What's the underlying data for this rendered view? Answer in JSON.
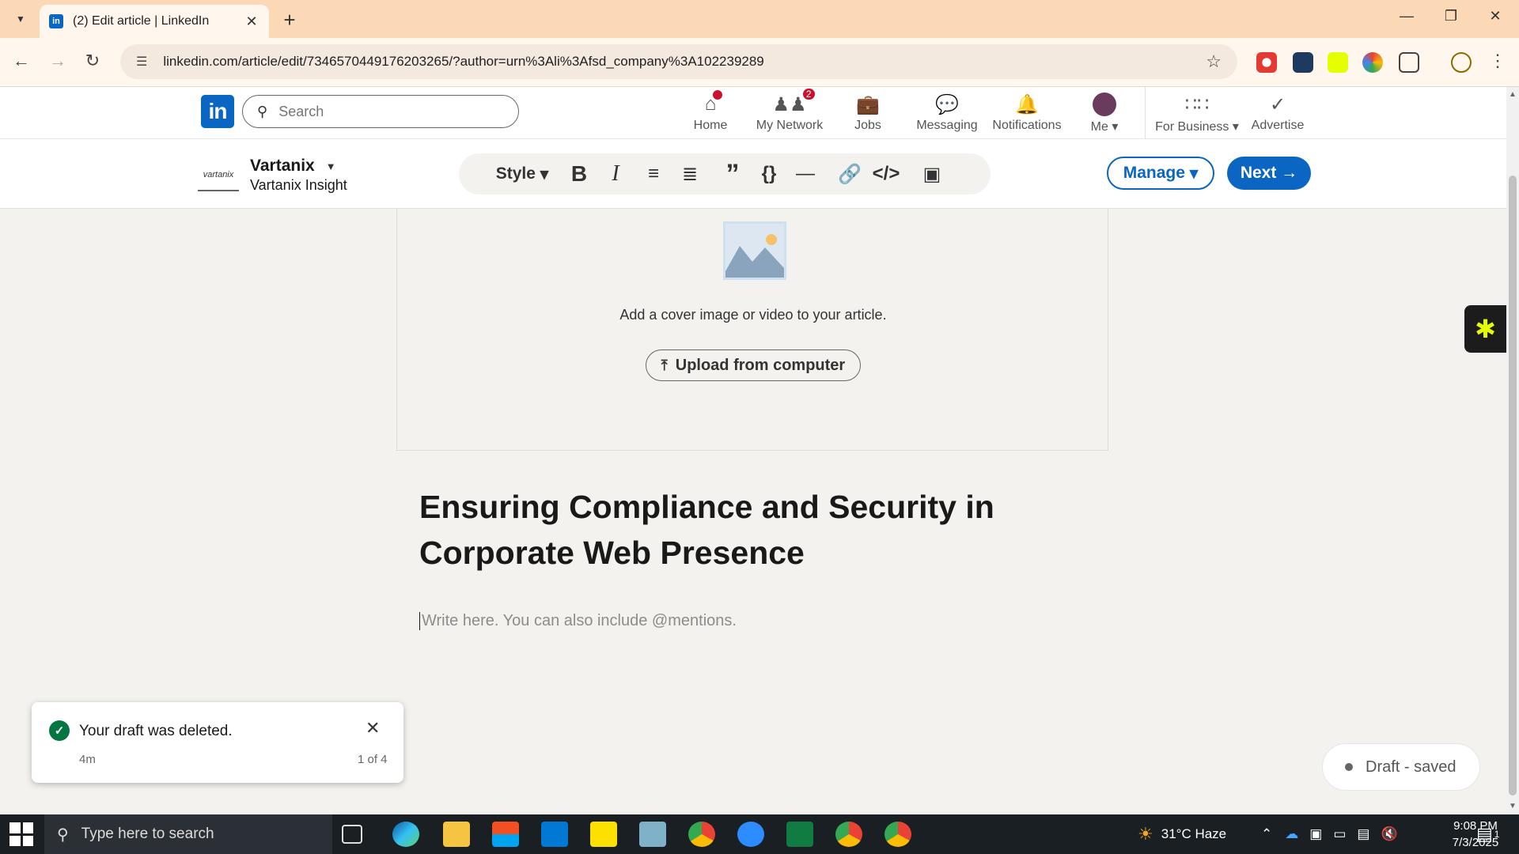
{
  "browser": {
    "tab_title": "(2) Edit article | LinkedIn",
    "tab_favicon": "in",
    "url": "linkedin.com/article/edit/7346570449176203265/?author=urn%3Ali%3Afsd_company%3A102239289"
  },
  "header": {
    "logo": "in",
    "search_placeholder": "Search",
    "nav": [
      {
        "label": "Home",
        "icon": "home-icon",
        "badge": ""
      },
      {
        "label": "My Network",
        "icon": "network-icon",
        "badge": "2"
      },
      {
        "label": "Jobs",
        "icon": "briefcase-icon",
        "badge": ""
      },
      {
        "label": "Messaging",
        "icon": "message-icon",
        "badge": ""
      },
      {
        "label": "Notifications",
        "icon": "bell-icon",
        "badge": ""
      },
      {
        "label": "Me",
        "icon": "avatar",
        "badge": ""
      },
      {
        "label": "For Business",
        "icon": "grid-icon",
        "badge": ""
      },
      {
        "label": "Advertise",
        "icon": "advertise-icon",
        "badge": ""
      }
    ]
  },
  "editor": {
    "author_name": "Vartanix",
    "author_sub": "Vartanix Insight",
    "author_logo_text": "vartanix",
    "style_label": "Style",
    "manage_label": "Manage",
    "next_label": "Next"
  },
  "cover": {
    "prompt": "Add a cover image or video to your article.",
    "upload_label": "Upload from computer"
  },
  "article": {
    "title": "Ensuring Compliance and Security in Corporate Web Presence",
    "body_placeholder": "Write here. You can also include @mentions."
  },
  "toast": {
    "message": "Your draft was deleted.",
    "time": "4m",
    "count": "1 of 4"
  },
  "draft_status": "Draft - saved",
  "taskbar": {
    "search_placeholder": "Type here to search",
    "weather": "31°C Haze",
    "time": "9:08 PM",
    "date": "7/3/2025",
    "notification_count": "1"
  },
  "colors": {
    "linkedin_blue": "#0a66c2",
    "tab_bar": "#fbd9b7",
    "badge_red": "#cb112d",
    "success_green": "#057642"
  }
}
